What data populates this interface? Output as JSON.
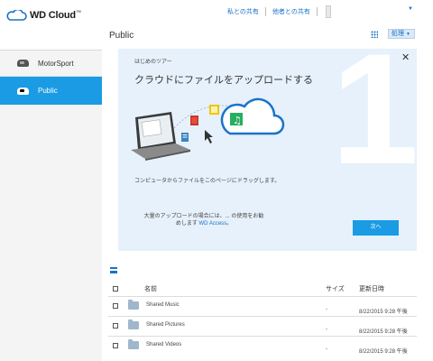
{
  "app": {
    "logo_text": "WD Cloud",
    "logo_tm": "™"
  },
  "header": {
    "links": [
      "私との共有",
      "他者との共有"
    ],
    "caret": "▼"
  },
  "sidebar": {
    "items": [
      {
        "label": "MotorSport",
        "icon": "cloud-drive-icon",
        "selected": false
      },
      {
        "label": "Public",
        "icon": "cloud-drive-icon",
        "selected": true
      }
    ]
  },
  "content": {
    "title": "Public",
    "action_label": "処理",
    "action_caret": "▼"
  },
  "tour": {
    "kicker": "はじめのツアー",
    "close": "✕",
    "heading": "クラウドにファイルをアップロードする",
    "step_number": "1",
    "description": "コンピュータからファイルをこのページにドラッグします。",
    "note_prefix": "大量のアップロードの場合には、... の使用をお勧",
    "note_line2": "めします",
    "note_link": "WD Access",
    "note_suffix": "。",
    "next_label": "次へ",
    "colors": {
      "accent": "#1a9be4",
      "panel_bg": "#e6f1fb"
    }
  },
  "file_list": {
    "columns": {
      "name": "名前",
      "size": "サイズ",
      "date": "更新日時"
    },
    "rows": [
      {
        "name": "Shared Music",
        "size": "-",
        "date": "8/22/2015 9:28 午後"
      },
      {
        "name": "Shared Pictures",
        "size": "-",
        "date": "8/22/2015 9:28 午後"
      },
      {
        "name": "Shared Videos",
        "size": "-",
        "date": "8/22/2015 9:28 午後"
      }
    ]
  }
}
